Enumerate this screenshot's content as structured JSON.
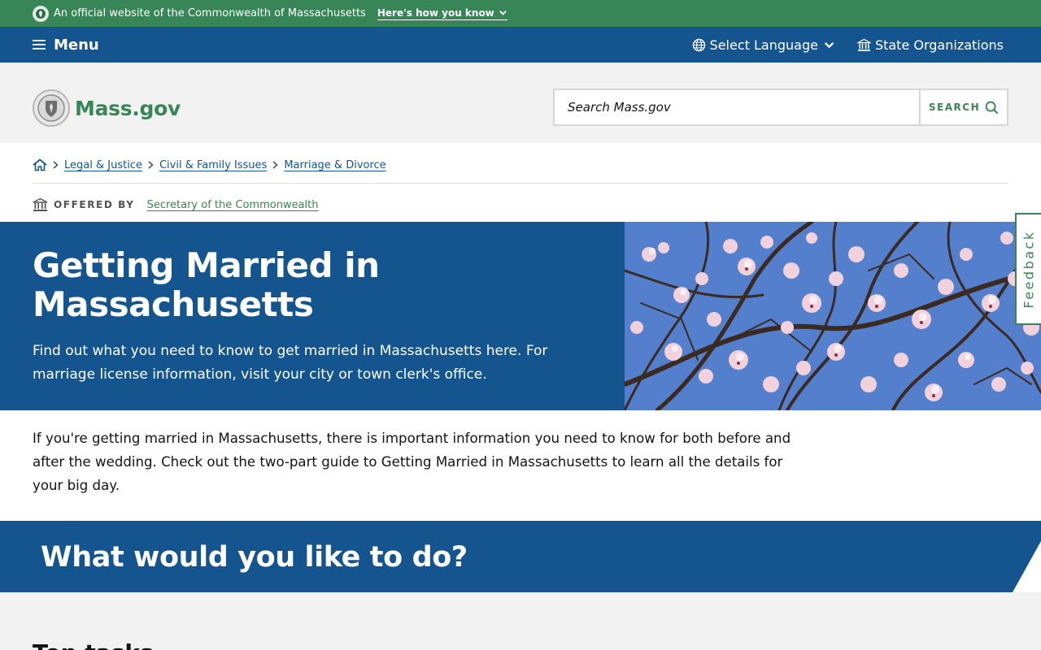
{
  "official_bar": {
    "text": "An official website of the Commonwealth of Massachusetts",
    "toggle_label": "Here's how you know"
  },
  "utility_nav": {
    "menu_label": "Menu",
    "language_label": "Select Language",
    "state_orgs_label": "State Organizations"
  },
  "header": {
    "logo_text": "Mass.gov",
    "search_placeholder": "Search Mass.gov",
    "search_button_label": "SEARCH"
  },
  "breadcrumb": {
    "items": [
      {
        "label": "Legal & Justice"
      },
      {
        "label": "Civil & Family Issues"
      },
      {
        "label": "Marriage & Divorce"
      }
    ]
  },
  "offered_by": {
    "label": "OFFERED BY",
    "org": "Secretary of the Commonwealth"
  },
  "hero": {
    "title": "Getting Married in Massachusetts",
    "description": "Find out what you need to know to get married in Massachusetts here. For marriage license information, visit your city or town clerk's office."
  },
  "feedback_label": "Feedback",
  "intro": "If you're getting married in Massachusetts, there is important information you need to know for both before and after the wedding. Check out the two-part guide to Getting Married in Massachusetts to learn all the details for your big day.",
  "todo_heading": "What would you like to do?",
  "top_tasks_heading": "Top tasks",
  "colors": {
    "official_green": "#388557",
    "nav_blue": "#14558f",
    "header_gray": "#f2f2f2",
    "link_blue": "#14558f",
    "text": "#141414"
  },
  "icons": {
    "official_seal": "seal-icon",
    "toggle": "chevron-down-icon",
    "menu": "hamburger-icon",
    "language": "globe-icon",
    "state_orgs": "building-icon",
    "search": "search-icon",
    "home": "home-icon",
    "breadcrumb_separator": "chevron-right-icon",
    "offered_by": "building-icon"
  }
}
